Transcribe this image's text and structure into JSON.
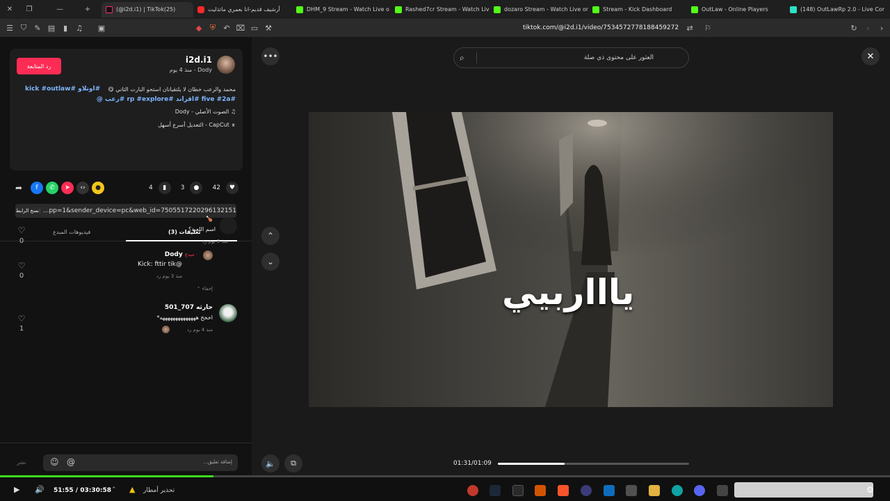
{
  "browser": {
    "tabs": [
      {
        "label": "(@i2d.i1) | TikTok(25)",
        "fav": "tt"
      },
      {
        "label": "أرشيف قديم-انا بعمري ماتذليت",
        "fav": "yt"
      },
      {
        "label": "DHM_9 Stream - Watch Live o",
        "fav": "kick"
      },
      {
        "label": "Rashed7cr Stream - Watch Liv",
        "fav": "kick"
      },
      {
        "label": "dozaro Stream - Watch Live or",
        "fav": "kick"
      },
      {
        "label": "Stream - Kick Dashboard",
        "fav": "kick"
      },
      {
        "label": "OutLaw - Online Players",
        "fav": "ol"
      },
      {
        "label": "(148) OutLawRp 2.0 - Live Com",
        "fav": "ow"
      }
    ],
    "url": "tiktok.com/@i2d.i1/video/7534572778188459272"
  },
  "post": {
    "follow_label": "رد المتابعة",
    "username": "i2d.i1",
    "subtitle": "Dody - منذ 4 يوم",
    "caption_line1": "محمد والرعب خطان لا يلتقيانان استحو البارت الثاني 😋",
    "caption_tags1": "#اوتلاو #kick #outlaw",
    "caption_tags2": "#five #2a #اقراند #rp #explore #رعب @",
    "sound": "الصوت الأصلي - Dody",
    "capcut": "CapCut - التعديل أسرع أسهل"
  },
  "stats": {
    "likes": "42",
    "comments": "3",
    "saves": "4"
  },
  "link": {
    "copy_label": "نسخ الرابط",
    "url_text": "...pp=1&sender_device=pc&web_id=7505517220296132151"
  },
  "tabs2": {
    "comments_tab": "(3) تعليقات",
    "creator_tab": "فيديوهات المبدع"
  },
  "comments": [
    {
      "name": "🍗",
      "text": "اسم اللعبة؟",
      "meta": "منذ 3 يوم      رد",
      "likes": "0"
    },
    {
      "name": "Dody",
      "badge": "· مبدع",
      "text": "Kick: fttir tik@",
      "meta": "منذ 3 يوم      رد",
      "likes": "0",
      "hide": "إخفاء"
    },
    {
      "name": "حارثه 707_501",
      "text": "اخخخ ههههههههههههههه*",
      "meta": "منذ 4 يوم      رد",
      "likes": "1"
    }
  ],
  "comment_input": {
    "placeholder": "إضافة تعليق...",
    "post_label": "نشر"
  },
  "search": {
    "placeholder": "العثور على محتوى ذي صلة"
  },
  "video": {
    "overlay_text": "ياااربيي",
    "time": "01:31/01:09",
    "progress": 0.35
  },
  "player": {
    "elapsed": "51:55 / 03:30:58",
    "warning": "تحذير أمطار",
    "seek_progress": 0.24
  },
  "colors": {
    "accent": "#fe2c55",
    "kick": "#53fc18",
    "seek": "#3ddc1f"
  }
}
